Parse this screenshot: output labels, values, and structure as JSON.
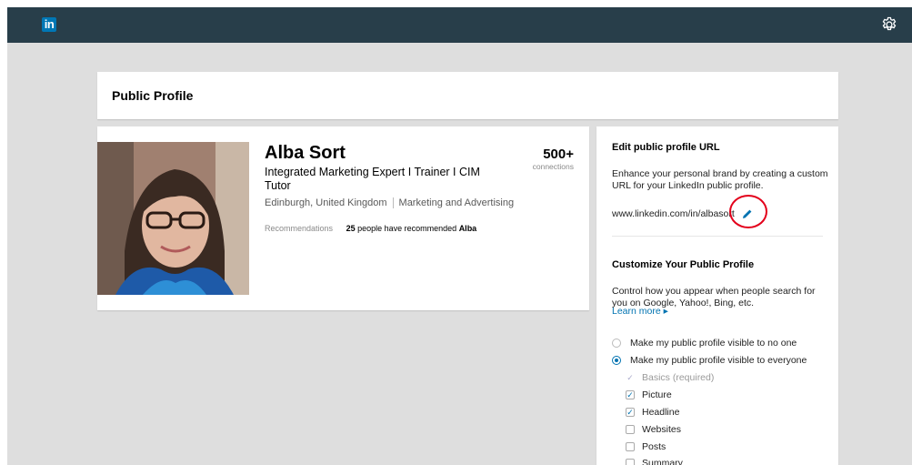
{
  "app": {
    "logo_text": "in",
    "settings_icon": "gear-icon"
  },
  "header": {
    "title": "Public Profile"
  },
  "profile": {
    "name": "Alba Sort",
    "headline": "Integrated Marketing Expert I Trainer I CIM Tutor",
    "location": "Edinburgh, United Kingdom",
    "industry": "Marketing and Advertising",
    "connections_count": "500+",
    "connections_label": "connections",
    "recommendations_label": "Recommendations",
    "recommendations_count": "25",
    "recommendations_text": "people have recommended",
    "recommendations_name": "Alba"
  },
  "sidebar": {
    "edit_url_title": "Edit public profile URL",
    "edit_url_desc": "Enhance your personal brand by creating a custom URL for your LinkedIn public profile.",
    "url_prefix": "www.linkedin.com/in/",
    "url_slug": "albasort",
    "customize_title": "Customize Your Public Profile",
    "customize_desc": "Control how you appear when people search for you on Google, Yahoo!, Bing, etc.",
    "learn_more": "Learn more ▸",
    "visibility_options": [
      {
        "label": "Make my public profile visible to no one",
        "selected": false
      },
      {
        "label": "Make my public profile visible to everyone",
        "selected": true
      }
    ],
    "sections": [
      {
        "label": "Basics (required)",
        "checked": true,
        "disabled": true
      },
      {
        "label": "Picture",
        "checked": true,
        "disabled": false
      },
      {
        "label": "Headline",
        "checked": true,
        "disabled": false
      },
      {
        "label": "Websites",
        "checked": false,
        "disabled": false
      },
      {
        "label": "Posts",
        "checked": false,
        "disabled": false
      },
      {
        "label": "Summary",
        "checked": false,
        "disabled": false
      }
    ]
  },
  "colors": {
    "topbar": "#283e4a",
    "brand": "#0077b5",
    "link": "#0073b1",
    "annotation": "#e3001b"
  }
}
